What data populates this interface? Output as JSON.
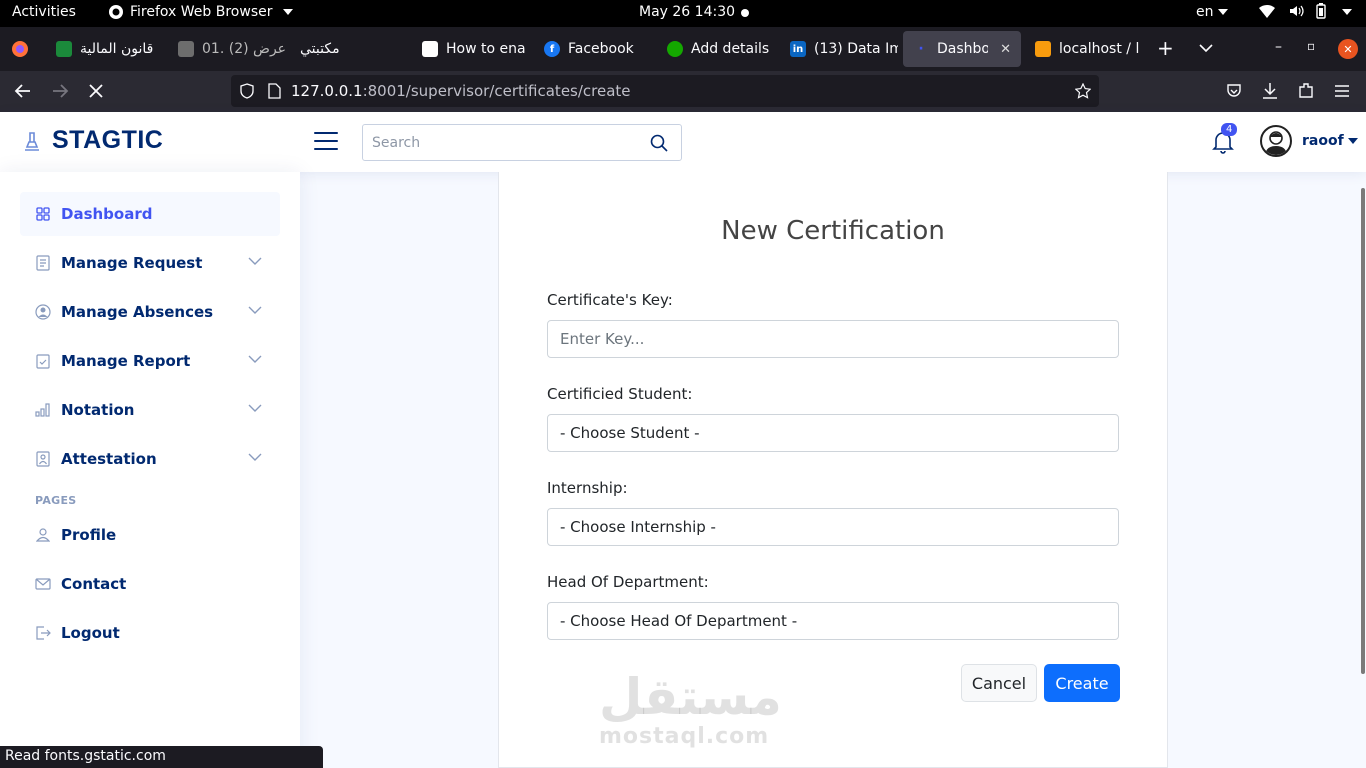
{
  "system": {
    "activities": "Activities",
    "app_menu": "Firefox Web Browser",
    "clock": "May 26  14:30",
    "language": "en"
  },
  "browser": {
    "tabs": [
      {
        "label": "قانون المالية",
        "favicon_color": "#1b8a3b"
      },
      {
        "label": "01. عرض (2)",
        "favicon_color": "#6d6d6d"
      },
      {
        "label": "مكتبتي",
        "favicon_color": "#1c1b22"
      },
      {
        "label": "How to ena",
        "favicon_color": "#ffffff"
      },
      {
        "label": "Facebook",
        "favicon_color": "#1877f2"
      },
      {
        "label": "Add details",
        "favicon_color": "#14a800"
      },
      {
        "label": "(13) Data Im",
        "favicon_color": "#0a66c2"
      },
      {
        "label": "Dashboar",
        "favicon_color": "#4154f1",
        "active": true
      },
      {
        "label": "localhost / l",
        "favicon_color": "#f89c0e"
      }
    ],
    "url_host": "127.0.0.1",
    "url_path": ":8001/supervisor/certificates/create",
    "status_text": "Read fonts.gstatic.com"
  },
  "app": {
    "brand": "STAGTIC",
    "search_placeholder": "Search",
    "notification_count": "4",
    "username": "raoof"
  },
  "sidebar": {
    "items": [
      {
        "label": "Dashboard",
        "icon": "grid-icon",
        "active": true
      },
      {
        "label": "Manage Request",
        "icon": "document-icon",
        "expandable": true
      },
      {
        "label": "Manage Absences",
        "icon": "person-circle-icon",
        "expandable": true
      },
      {
        "label": "Manage Report",
        "icon": "clipboard-check-icon",
        "expandable": true
      },
      {
        "label": "Notation",
        "icon": "bar-chart-icon",
        "expandable": true
      },
      {
        "label": "Attestation",
        "icon": "file-person-icon",
        "expandable": true
      }
    ],
    "pages_heading": "PAGES",
    "pages": [
      {
        "label": "Profile",
        "icon": "person-icon"
      },
      {
        "label": "Contact",
        "icon": "envelope-icon"
      },
      {
        "label": "Logout",
        "icon": "box-arrow-right-icon"
      }
    ]
  },
  "form": {
    "title": "New Certification",
    "key_label": "Certificate's Key:",
    "key_placeholder": "Enter Key...",
    "student_label": "Certificied Student:",
    "student_value": "- Choose Student -",
    "internship_label": "Internship:",
    "internship_value": "- Choose Internship -",
    "hod_label": "Head Of Department:",
    "hod_value": "- Choose Head Of Department -",
    "cancel_label": "Cancel",
    "create_label": "Create"
  },
  "watermark": {
    "arabic": "مستقل",
    "latin": "mostaql.com"
  },
  "colors": {
    "brand": "#012970",
    "accent": "#4154f1",
    "primary_button": "#0d6efd"
  }
}
